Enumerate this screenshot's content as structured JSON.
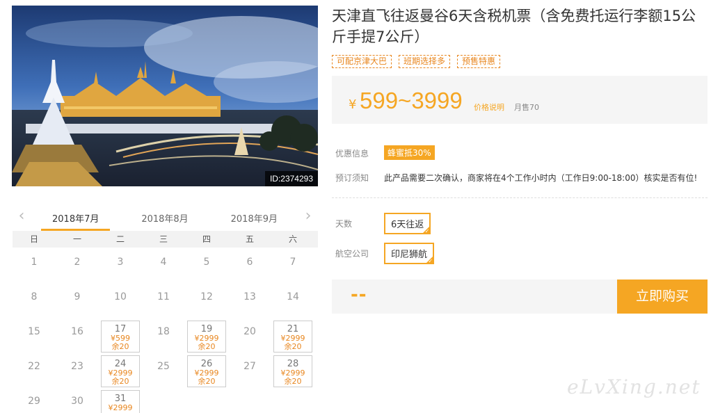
{
  "photo": {
    "id_label": "ID:2374293"
  },
  "product": {
    "title": "天津直飞往返曼谷6天含税机票（含免费托运行李额15公斤手提7公斤）",
    "tags": [
      "可配京津大巴",
      "班期选择多",
      "预售特惠"
    ]
  },
  "price": {
    "symbol": "¥",
    "range": "599~3999",
    "note": "价格说明",
    "sales": "月售70"
  },
  "promo": {
    "label": "优惠信息",
    "badge": "蜂蜜抵30%"
  },
  "notice": {
    "label": "预订须知",
    "text": "此产品需要二次确认，商家将在4个工作小时内（工作日9:00-18:00）核实是否有位!"
  },
  "options": {
    "days_label": "天数",
    "days_value": "6天往返",
    "airline_label": "航空公司",
    "airline_value": "印尼狮航"
  },
  "purchase": {
    "total": "--",
    "button": "立即购买"
  },
  "calendar": {
    "months": [
      "2018年7月",
      "2018年8月",
      "2018年9月"
    ],
    "active_month": 0,
    "weekdays": [
      "日",
      "一",
      "二",
      "三",
      "四",
      "五",
      "六"
    ],
    "days": [
      {
        "d": "1"
      },
      {
        "d": "2"
      },
      {
        "d": "3"
      },
      {
        "d": "4"
      },
      {
        "d": "5"
      },
      {
        "d": "6"
      },
      {
        "d": "7"
      },
      {
        "d": "8"
      },
      {
        "d": "9"
      },
      {
        "d": "10"
      },
      {
        "d": "11"
      },
      {
        "d": "12"
      },
      {
        "d": "13"
      },
      {
        "d": "14"
      },
      {
        "d": "15"
      },
      {
        "d": "16"
      },
      {
        "d": "17",
        "price": "¥599",
        "stock": "余20"
      },
      {
        "d": "18"
      },
      {
        "d": "19",
        "price": "¥2999",
        "stock": "余20"
      },
      {
        "d": "20"
      },
      {
        "d": "21",
        "price": "¥2999",
        "stock": "余20"
      },
      {
        "d": "22"
      },
      {
        "d": "23"
      },
      {
        "d": "24",
        "price": "¥2999",
        "stock": "余20"
      },
      {
        "d": "25"
      },
      {
        "d": "26",
        "price": "¥2999",
        "stock": "余20"
      },
      {
        "d": "27"
      },
      {
        "d": "28",
        "price": "¥2999",
        "stock": "余20"
      },
      {
        "d": "29"
      },
      {
        "d": "30"
      },
      {
        "d": "31",
        "price": "¥2999",
        "stock": ""
      }
    ]
  },
  "watermark": "eLvXing.net",
  "colors": {
    "accent": "#f5a623",
    "price_text": "#e8861e"
  }
}
